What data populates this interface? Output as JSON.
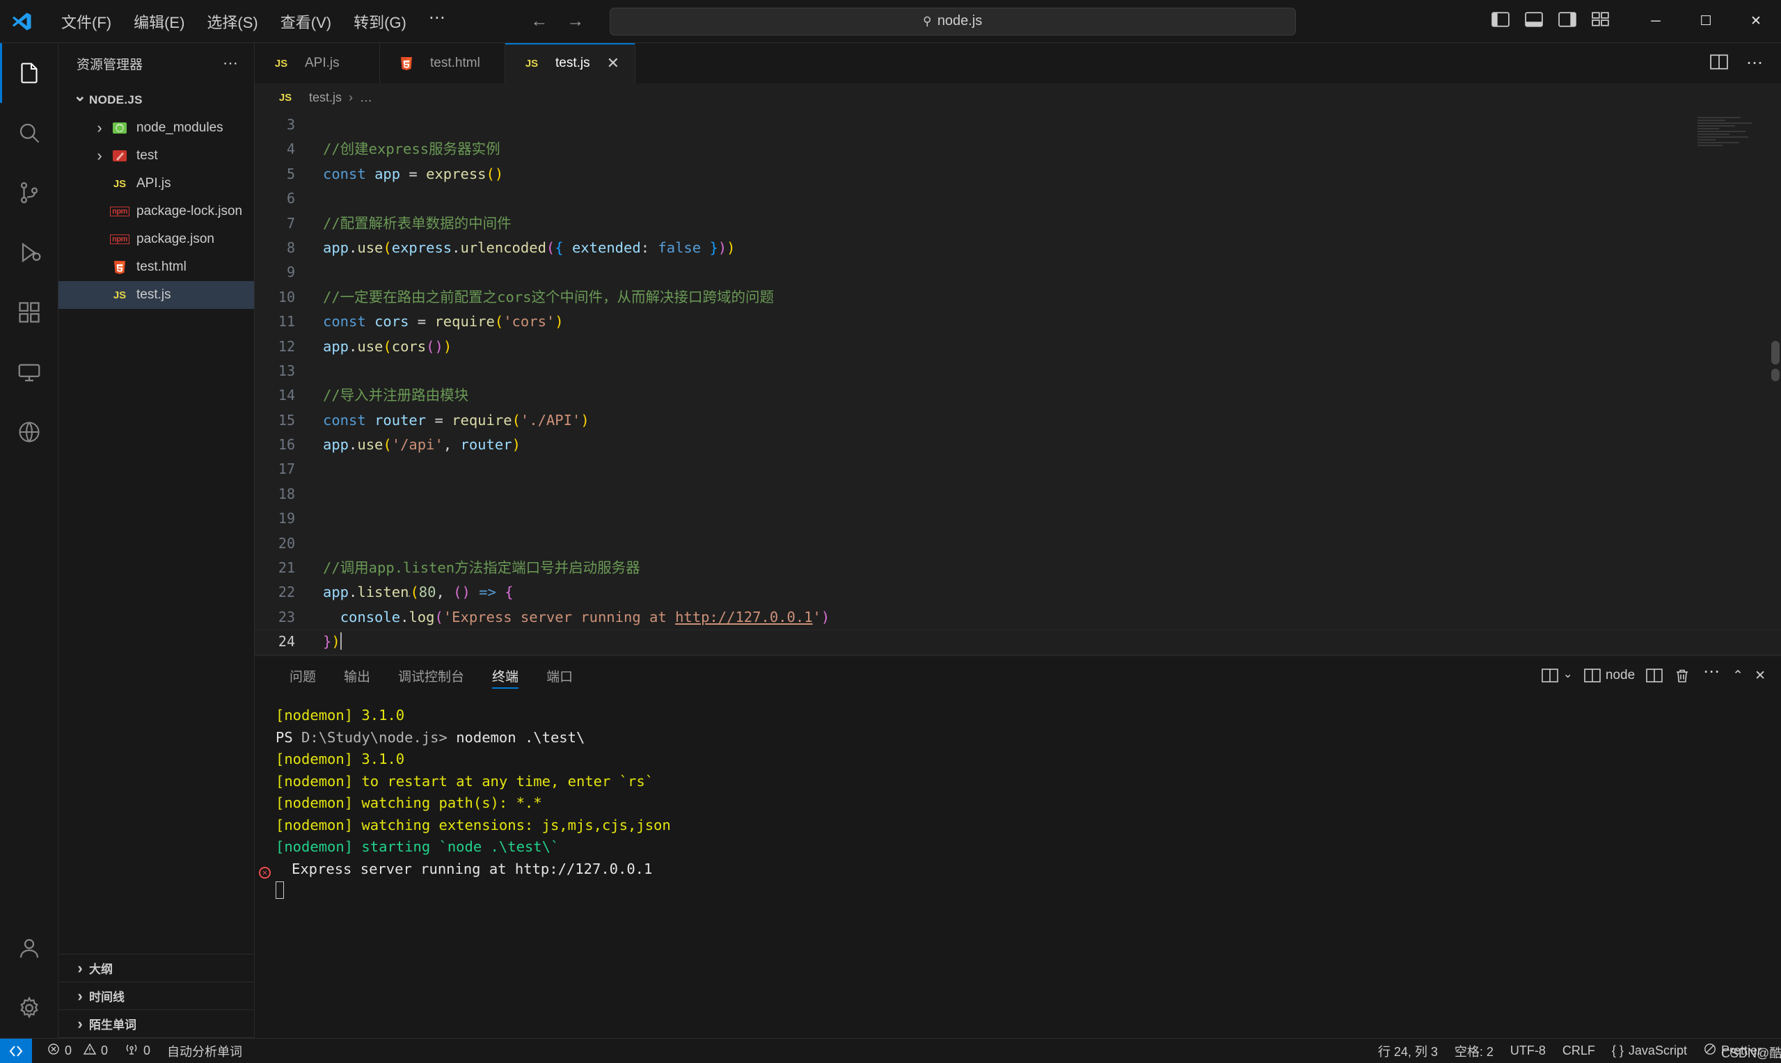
{
  "titlebar": {
    "logo": "vscode-logo",
    "menus": [
      "文件(F)",
      "编辑(E)",
      "选择(S)",
      "查看(V)",
      "转到(G)"
    ],
    "more_label": "⋯",
    "back_arrow": "←",
    "forward_arrow": "→",
    "command_center": {
      "icon": "search-icon",
      "text": "node.js"
    },
    "layout_icons": [
      "toggle-primary-sidebar-icon",
      "toggle-panel-icon",
      "toggle-secondary-sidebar-icon",
      "customize-layout-icon"
    ],
    "window_controls": {
      "minimize": "─",
      "maximize": "☐",
      "close": "✕"
    }
  },
  "activitybar": {
    "items": [
      {
        "name": "explorer",
        "icon": "files-icon",
        "active": true
      },
      {
        "name": "search",
        "icon": "search-icon",
        "active": false
      },
      {
        "name": "source-control",
        "icon": "source-control-icon",
        "active": false
      },
      {
        "name": "run-and-debug",
        "icon": "debug-icon",
        "active": false
      },
      {
        "name": "extensions",
        "icon": "extensions-icon",
        "active": false
      },
      {
        "name": "remote-explorer",
        "icon": "remote-icon",
        "active": false
      },
      {
        "name": "docker",
        "icon": "docker-icon",
        "active": false
      }
    ],
    "bottom": [
      {
        "name": "accounts",
        "icon": "account-icon"
      },
      {
        "name": "settings",
        "icon": "gear-icon"
      }
    ]
  },
  "sidebar": {
    "title": "资源管理器",
    "more_actions": "⋯",
    "root": {
      "label": "NODE.JS",
      "expanded": true
    },
    "files": [
      {
        "label": "node_modules",
        "icon": "node-folder-icon",
        "type": "folder",
        "expanded": false,
        "indent": 1
      },
      {
        "label": "test",
        "icon": "test-folder-icon",
        "type": "folder",
        "expanded": false,
        "indent": 1
      },
      {
        "label": "API.js",
        "icon": "js-icon",
        "type": "file",
        "indent": 1
      },
      {
        "label": "package-lock.json",
        "icon": "npm-icon",
        "type": "file",
        "indent": 1
      },
      {
        "label": "package.json",
        "icon": "npm-icon",
        "type": "file",
        "indent": 1
      },
      {
        "label": "test.html",
        "icon": "html-icon",
        "type": "file",
        "indent": 1
      },
      {
        "label": "test.js",
        "icon": "js-icon",
        "type": "file",
        "indent": 1,
        "selected": true
      }
    ],
    "sections": [
      "大纲",
      "时间线",
      "陌生单词"
    ]
  },
  "editor": {
    "tabs": [
      {
        "label": "API.js",
        "icon": "js-icon",
        "active": false,
        "closable": false
      },
      {
        "label": "test.html",
        "icon": "html-icon",
        "active": false,
        "closable": false
      },
      {
        "label": "test.js",
        "icon": "js-icon",
        "active": true,
        "closable": true,
        "close_label": "✕"
      }
    ],
    "tab_actions": [
      "split-editor-icon",
      "more-actions-icon"
    ],
    "breadcrumb": {
      "icon": "js-icon",
      "file": "test.js",
      "separator": "›",
      "rest": "…"
    },
    "lines": [
      {
        "n": 3,
        "segments": []
      },
      {
        "n": 4,
        "segments": [
          {
            "t": "//创建express服务器实例",
            "c": "cm"
          }
        ]
      },
      {
        "n": 5,
        "segments": [
          {
            "t": "const",
            "c": "kw"
          },
          {
            "t": " ",
            "c": "op"
          },
          {
            "t": "app",
            "c": "var"
          },
          {
            "t": " = ",
            "c": "op"
          },
          {
            "t": "express",
            "c": "fn"
          },
          {
            "t": "()",
            "c": "p1"
          }
        ]
      },
      {
        "n": 6,
        "segments": []
      },
      {
        "n": 7,
        "segments": [
          {
            "t": "//配置解析表单数据的中间件",
            "c": "cm"
          }
        ]
      },
      {
        "n": 8,
        "segments": [
          {
            "t": "app",
            "c": "var"
          },
          {
            "t": ".",
            "c": "op"
          },
          {
            "t": "use",
            "c": "fn"
          },
          {
            "t": "(",
            "c": "p1"
          },
          {
            "t": "express",
            "c": "var"
          },
          {
            "t": ".",
            "c": "op"
          },
          {
            "t": "urlencoded",
            "c": "fn"
          },
          {
            "t": "(",
            "c": "p2"
          },
          {
            "t": "{",
            "c": "p3"
          },
          {
            "t": " ",
            "c": "op"
          },
          {
            "t": "extended",
            "c": "var"
          },
          {
            "t": ": ",
            "c": "op"
          },
          {
            "t": "false",
            "c": "lit"
          },
          {
            "t": " ",
            "c": "op"
          },
          {
            "t": "}",
            "c": "p3"
          },
          {
            "t": ")",
            "c": "p2"
          },
          {
            "t": ")",
            "c": "p1"
          }
        ]
      },
      {
        "n": 9,
        "segments": []
      },
      {
        "n": 10,
        "segments": [
          {
            "t": "//一定要在路由之前配置之cors这个中间件，从而解决接口跨域的问题",
            "c": "cm"
          }
        ]
      },
      {
        "n": 11,
        "segments": [
          {
            "t": "const",
            "c": "kw"
          },
          {
            "t": " ",
            "c": "op"
          },
          {
            "t": "cors",
            "c": "var"
          },
          {
            "t": " = ",
            "c": "op"
          },
          {
            "t": "require",
            "c": "fn"
          },
          {
            "t": "(",
            "c": "p1"
          },
          {
            "t": "'cors'",
            "c": "str"
          },
          {
            "t": ")",
            "c": "p1"
          }
        ]
      },
      {
        "n": 12,
        "segments": [
          {
            "t": "app",
            "c": "var"
          },
          {
            "t": ".",
            "c": "op"
          },
          {
            "t": "use",
            "c": "fn"
          },
          {
            "t": "(",
            "c": "p1"
          },
          {
            "t": "cors",
            "c": "fn"
          },
          {
            "t": "(",
            "c": "p2"
          },
          {
            "t": ")",
            "c": "p2"
          },
          {
            "t": ")",
            "c": "p1"
          }
        ]
      },
      {
        "n": 13,
        "segments": []
      },
      {
        "n": 14,
        "segments": [
          {
            "t": "//导入并注册路由模块",
            "c": "cm"
          }
        ]
      },
      {
        "n": 15,
        "segments": [
          {
            "t": "const",
            "c": "kw"
          },
          {
            "t": " ",
            "c": "op"
          },
          {
            "t": "router",
            "c": "var"
          },
          {
            "t": " = ",
            "c": "op"
          },
          {
            "t": "require",
            "c": "fn"
          },
          {
            "t": "(",
            "c": "p1"
          },
          {
            "t": "'./API'",
            "c": "str"
          },
          {
            "t": ")",
            "c": "p1"
          }
        ]
      },
      {
        "n": 16,
        "segments": [
          {
            "t": "app",
            "c": "var"
          },
          {
            "t": ".",
            "c": "op"
          },
          {
            "t": "use",
            "c": "fn"
          },
          {
            "t": "(",
            "c": "p1"
          },
          {
            "t": "'/api'",
            "c": "str"
          },
          {
            "t": ", ",
            "c": "op"
          },
          {
            "t": "router",
            "c": "var"
          },
          {
            "t": ")",
            "c": "p1"
          }
        ]
      },
      {
        "n": 17,
        "segments": []
      },
      {
        "n": 18,
        "segments": []
      },
      {
        "n": 19,
        "segments": []
      },
      {
        "n": 20,
        "segments": []
      },
      {
        "n": 21,
        "segments": [
          {
            "t": "//调用app.listen方法指定端口号并启动服务器",
            "c": "cm"
          }
        ]
      },
      {
        "n": 22,
        "segments": [
          {
            "t": "app",
            "c": "var"
          },
          {
            "t": ".",
            "c": "op"
          },
          {
            "t": "listen",
            "c": "fn"
          },
          {
            "t": "(",
            "c": "p1"
          },
          {
            "t": "80",
            "c": "num"
          },
          {
            "t": ", ",
            "c": "op"
          },
          {
            "t": "(",
            "c": "p2"
          },
          {
            "t": ")",
            "c": "p2"
          },
          {
            "t": " => ",
            "c": "kw"
          },
          {
            "t": "{",
            "c": "p2"
          }
        ]
      },
      {
        "n": 23,
        "segments": [
          {
            "t": "  ",
            "c": "op"
          },
          {
            "t": "console",
            "c": "var"
          },
          {
            "t": ".",
            "c": "op"
          },
          {
            "t": "log",
            "c": "fn"
          },
          {
            "t": "(",
            "c": "p2"
          },
          {
            "t": "'Express server running at ",
            "c": "str"
          },
          {
            "t": "http://127.0.0.1",
            "c": "url"
          },
          {
            "t": "'",
            "c": "str"
          },
          {
            "t": ")",
            "c": "p2"
          }
        ]
      },
      {
        "n": 24,
        "segments": [
          {
            "t": "}",
            "c": "p2"
          },
          {
            "t": ")",
            "c": "p1"
          }
        ],
        "current": true
      }
    ]
  },
  "panel": {
    "tabs": [
      "问题",
      "输出",
      "调试控制台",
      "终端",
      "端口"
    ],
    "active_tab": "终端",
    "actions": {
      "split_dropdown": "split-terminal-dropdown-icon",
      "terminal_name": "node",
      "split": "split-terminal-icon",
      "kill": "trash-icon",
      "more": "⋯",
      "maximize": "⌃",
      "close": "✕"
    },
    "terminal_lines": [
      {
        "parts": [
          {
            "t": "[nodemon] 3.1.0",
            "c": "t-yellow"
          }
        ]
      },
      {
        "parts": [
          {
            "t": "PS ",
            "c": "t-white"
          },
          {
            "t": "D:\\Study\\node.js> ",
            "c": "t-grey"
          },
          {
            "t": "nodemon .\\test\\",
            "c": "t-white"
          }
        ]
      },
      {
        "parts": [
          {
            "t": "[nodemon] 3.1.0",
            "c": "t-yellow"
          }
        ]
      },
      {
        "parts": [
          {
            "t": "[nodemon] to restart at any time, enter `rs`",
            "c": "t-yellow"
          }
        ]
      },
      {
        "parts": [
          {
            "t": "[nodemon] watching path(s): *.*",
            "c": "t-yellow"
          }
        ]
      },
      {
        "parts": [
          {
            "t": "[nodemon] watching extensions: js,mjs,cjs,json",
            "c": "t-yellow"
          }
        ]
      },
      {
        "parts": [
          {
            "t": "[nodemon] starting `node .\\test\\`",
            "c": "t-green"
          }
        ]
      },
      {
        "parts": [
          {
            "t": "Express server running at http://127.0.0.1",
            "c": "t-white"
          }
        ],
        "error_marker": true
      }
    ]
  },
  "statusbar": {
    "remote_icon": "remote-window-icon",
    "errors": {
      "icon": "error-icon",
      "count": "0"
    },
    "warnings": {
      "icon": "warning-icon",
      "count": "0"
    },
    "ports": {
      "icon": "radio-tower-icon",
      "count": "0"
    },
    "analysis_label": "自动分析单词",
    "cursor_position": "行 24, 列 3",
    "indentation": "空格: 2",
    "encoding": "UTF-8",
    "eol": "CRLF",
    "language": "JavaScript",
    "language_icon": "{ }",
    "prettier_icon": "prettier-disabled-icon",
    "prettier_label": "Prettier",
    "watermark": "CSDN@酷七哦噜~"
  }
}
